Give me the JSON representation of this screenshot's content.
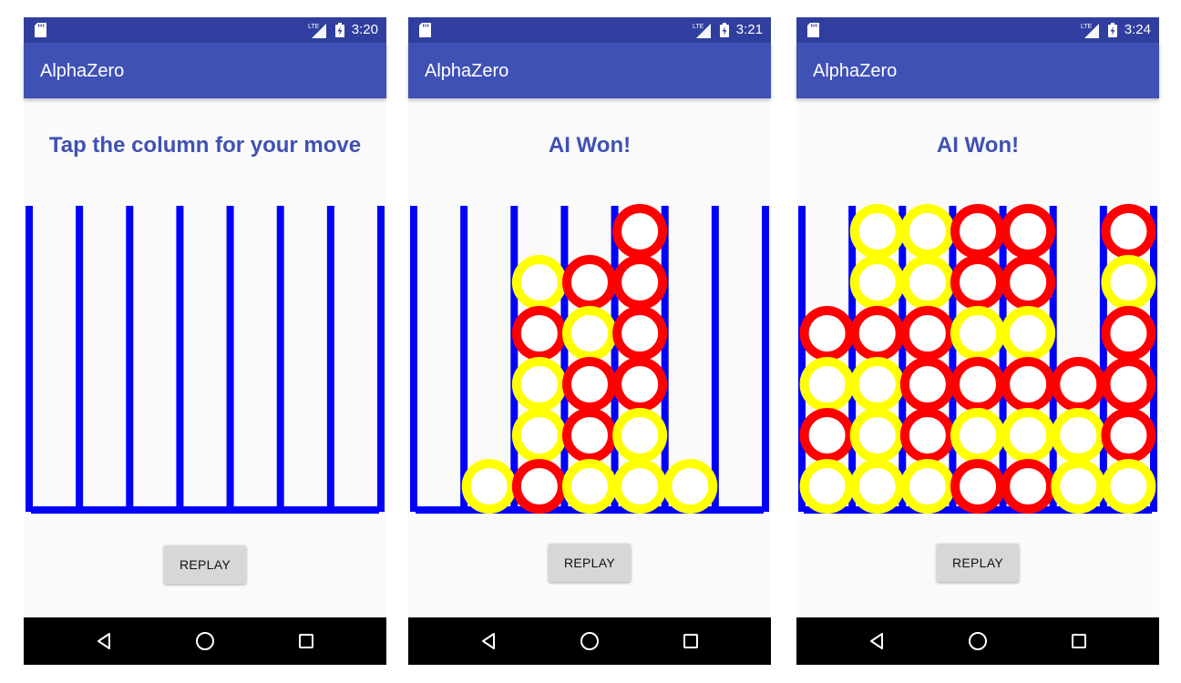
{
  "colors": {
    "status_bar": "#303f9f",
    "app_bar": "#3f51b5",
    "message_text": "#3f51b5",
    "board_lines": "#0000ff",
    "ai_disc": "#ff0000",
    "player_disc": "#ffff00",
    "button_bg": "#d6d7d7",
    "nav_bar": "#000000"
  },
  "board_spec": {
    "columns": 7,
    "rows": 6
  },
  "screens": [
    {
      "status": {
        "time": "3:20",
        "icons": [
          "sd-card-icon",
          "lte-signal-icon",
          "battery-charging-icon"
        ]
      },
      "app_title": "AlphaZero",
      "message": "Tap the column for your move",
      "replay_label": "REPLAY",
      "nav_icons": [
        "back-icon",
        "home-icon",
        "recents-icon"
      ],
      "board": [
        ".......",
        ".......",
        ".......",
        ".......",
        ".......",
        "......."
      ]
    },
    {
      "status": {
        "time": "3:21",
        "icons": [
          "sd-card-icon",
          "lte-signal-icon",
          "battery-charging-icon"
        ]
      },
      "app_title": "AlphaZero",
      "message": "AI Won!",
      "replay_label": "REPLAY",
      "nav_icons": [
        "back-icon",
        "home-icon",
        "recents-icon"
      ],
      "board": [
        "....R..",
        "..YRR..",
        "..RYR..",
        "..YRR..",
        "..YRY..",
        ".YRYYY."
      ]
    },
    {
      "status": {
        "time": "3:24",
        "icons": [
          "sd-card-icon",
          "lte-signal-icon",
          "battery-charging-icon"
        ]
      },
      "app_title": "AlphaZero",
      "message": "AI Won!",
      "replay_label": "REPLAY",
      "nav_icons": [
        "back-icon",
        "home-icon",
        "recents-icon"
      ],
      "board": [
        ".YYRR.R",
        ".YYRR.Y",
        "RRRYY.R",
        "YYRRRRR",
        "RYRYYYR",
        "YYYRRYY"
      ]
    }
  ]
}
